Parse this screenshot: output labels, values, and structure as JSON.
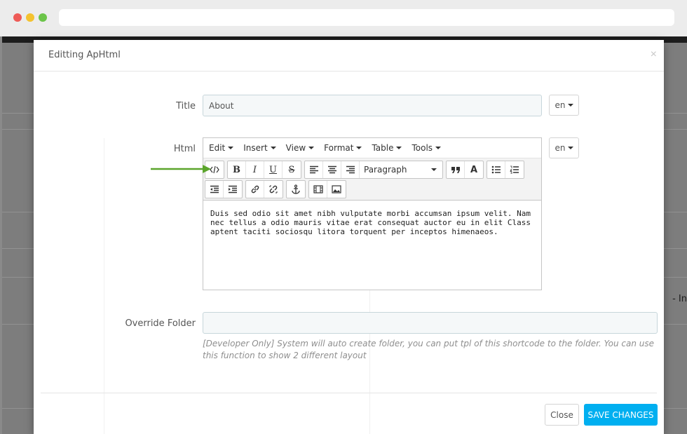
{
  "modal": {
    "title": "Editting ApHtml",
    "close_icon": "×"
  },
  "form": {
    "title_label": "Title",
    "title_value": "About",
    "title_lang": "en",
    "html_label": "Html",
    "html_lang": "en",
    "override_label": "Override Folder",
    "override_value": "",
    "help_text": "[Developer Only] System will auto create folder, you can put tpl of this shortcode to the folder. You can use this function to show 2 different layout"
  },
  "editor": {
    "menus": [
      "Edit",
      "Insert",
      "View",
      "Format",
      "Table",
      "Tools"
    ],
    "format_select": "Paragraph",
    "content": "Duis sed odio sit amet nibh vulputate morbi accumsan ipsum velit. Nam nec tellus a odio mauris vitae erat consequat auctor eu in elit Class aptent taciti sociosqu litora torquent per inceptos himenaeos."
  },
  "footer": {
    "close_label": "Close",
    "save_label": "SAVE CHANGES"
  },
  "background": {
    "partial_text": "- In"
  },
  "colors": {
    "primary": "#00aff0",
    "arrow": "#5ba52c"
  }
}
